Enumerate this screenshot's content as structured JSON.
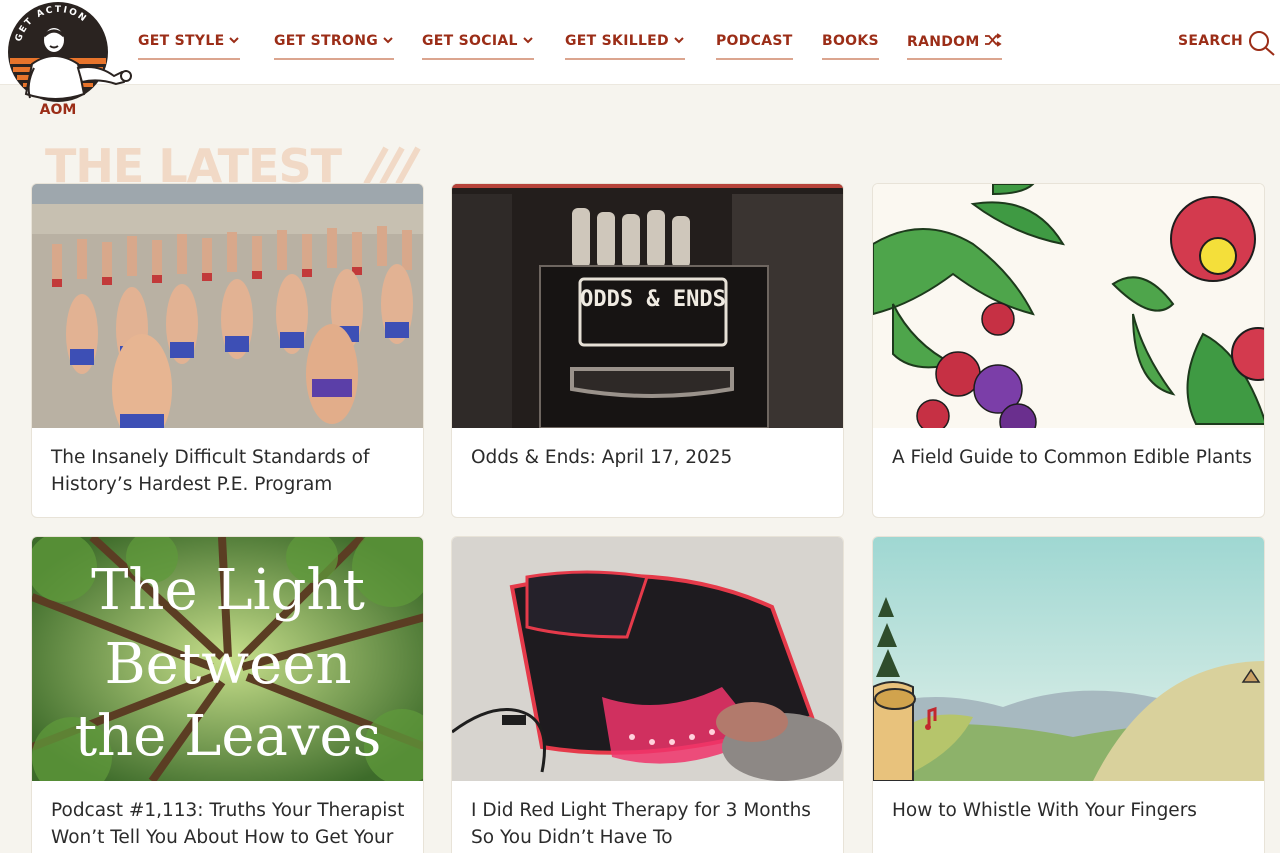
{
  "logo": {
    "ring_text": "GET ACTION",
    "badge": "AOM"
  },
  "nav": {
    "items": [
      {
        "label": "GET STYLE",
        "dropdown": true
      },
      {
        "label": "GET STRONG",
        "dropdown": true
      },
      {
        "label": "GET SOCIAL",
        "dropdown": true
      },
      {
        "label": "GET SKILLED",
        "dropdown": true
      },
      {
        "label": "PODCAST",
        "dropdown": false
      },
      {
        "label": "BOOKS",
        "dropdown": false
      },
      {
        "label": "RANDOM",
        "dropdown": false,
        "icon": "shuffle-icon"
      }
    ],
    "search_label": "SEARCH"
  },
  "section": {
    "heading": "THE LATEST"
  },
  "articles": [
    {
      "title": "The Insanely Difficult Standards of History’s Hardest P.E. Program"
    },
    {
      "title": "Odds & Ends: April 17, 2025",
      "image_text": "ODDS & ENDS"
    },
    {
      "title": "A Field Guide to Common Edible Plants"
    },
    {
      "title": "Podcast #1,113: Truths Your Therapist Won’t Tell You About How to Get Your",
      "image_text": [
        "The Light",
        "Between",
        "the Leaves"
      ]
    },
    {
      "title": "I Did Red Light Therapy for 3 Months So You Didn’t Have To"
    },
    {
      "title": "How to Whistle With Your Fingers"
    }
  ],
  "colors": {
    "brand": "#9b2d17",
    "underline": "#dba58f",
    "heading": "#f1d9c6",
    "background": "#f6f4ee"
  }
}
